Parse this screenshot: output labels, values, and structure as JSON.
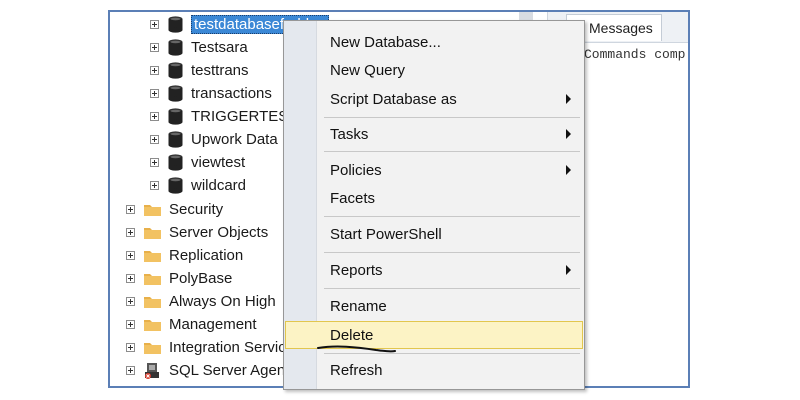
{
  "tree": {
    "databases": [
      {
        "label": "testdatabaseforblog",
        "selected": true
      },
      {
        "label": "Testsara"
      },
      {
        "label": "testtrans"
      },
      {
        "label": "transactions"
      },
      {
        "label": "TRIGGERTEST"
      },
      {
        "label": "Upwork Data"
      },
      {
        "label": "viewtest"
      },
      {
        "label": "wildcard"
      }
    ],
    "folders": [
      {
        "label": "Security"
      },
      {
        "label": "Server Objects"
      },
      {
        "label": "Replication"
      },
      {
        "label": "PolyBase"
      },
      {
        "label": "Always On High"
      },
      {
        "label": "Management"
      },
      {
        "label": "Integration Servic"
      },
      {
        "label": "SQL Server Agen"
      }
    ]
  },
  "results_pane": {
    "tab_label": "Messages",
    "message_text": "Commands comp"
  },
  "context_menu": {
    "items": [
      {
        "label": "New Database..."
      },
      {
        "label": "New Query"
      },
      {
        "label": "Script Database as",
        "submenu": true
      },
      {
        "label": "Tasks",
        "submenu": true
      },
      {
        "label": "Policies",
        "submenu": true
      },
      {
        "label": "Facets"
      },
      {
        "label": "Start PowerShell"
      },
      {
        "label": "Reports",
        "submenu": true
      },
      {
        "label": "Rename"
      },
      {
        "label": "Delete",
        "highlighted": true
      },
      {
        "label": "Refresh"
      }
    ]
  },
  "colors": {
    "selection": "#3b88d6",
    "highlight_bg": "#fcf3c5",
    "highlight_border": "#e2c64e",
    "folder": "#e8b04a",
    "frame_border": "#5b7fb6"
  }
}
